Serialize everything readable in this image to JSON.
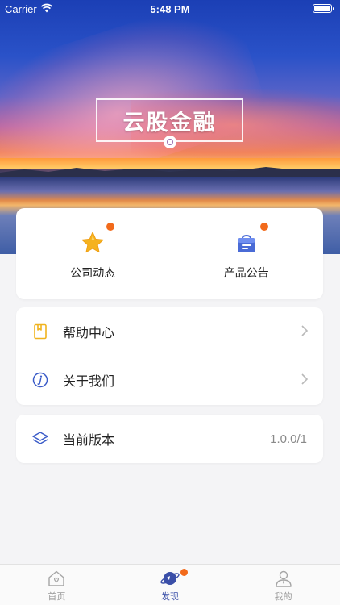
{
  "status_bar": {
    "carrier": "Carrier",
    "time": "5:48 PM"
  },
  "banner": {
    "brand_title": "云股金融"
  },
  "quick_links": [
    {
      "label": "公司动态",
      "icon": "star-icon",
      "badge": true
    },
    {
      "label": "产品公告",
      "icon": "notice-bag-icon",
      "badge": true
    }
  ],
  "menu": [
    {
      "label": "帮助中心",
      "icon": "help-book-icon"
    },
    {
      "label": "关于我们",
      "icon": "info-icon"
    }
  ],
  "version_row": {
    "label": "当前版本",
    "value": "1.0.0/1",
    "icon": "layers-icon"
  },
  "tab_bar": [
    {
      "label": "首页",
      "icon": "home-icon",
      "active": false
    },
    {
      "label": "发现",
      "icon": "planet-icon",
      "active": true,
      "badge": true
    },
    {
      "label": "我的",
      "icon": "user-icon",
      "active": false
    }
  ],
  "colors": {
    "accent": "#3a4fa8",
    "badge": "#f26a1b",
    "star": "#f5b21e",
    "background": "#f4f4f6"
  }
}
